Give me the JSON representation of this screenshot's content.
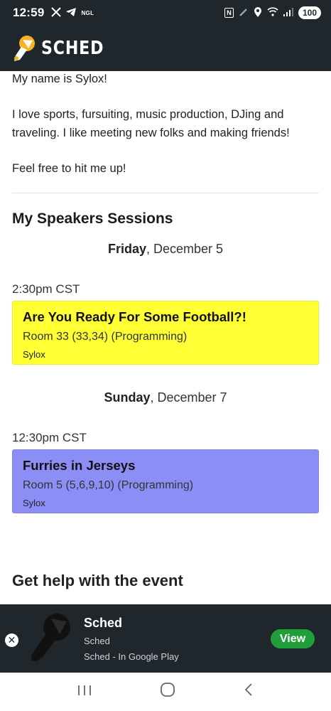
{
  "status_bar": {
    "time": "12:59",
    "left_icons": [
      "x-icon",
      "telegram-icon",
      "ngl-icon"
    ],
    "ngl_text": "NGL",
    "nfc_text": "N",
    "battery": "100"
  },
  "header": {
    "logo_text": "SCHED"
  },
  "bio": {
    "line1": "My name is Sylox!",
    "line2": "I love sports, fursuiting, music production, DJing and traveling. I like meeting new folks and making friends!",
    "line3": "Feel free to hit me up!"
  },
  "speaker_sessions": {
    "title": "My Speakers Sessions",
    "days": [
      {
        "weekday": "Friday",
        "date": ", December 5",
        "time": "2:30pm CST",
        "session": {
          "title": "Are You Ready For Some Football?!",
          "room": "Room 33 (33,34) (Programming)",
          "speaker": "Sylox",
          "color": "#ffff33"
        }
      },
      {
        "weekday": "Sunday",
        "date": ", December 7",
        "time": "12:30pm CST",
        "session": {
          "title": "Furries in Jerseys",
          "room": "Room 5 (5,6,9,10) (Programming)",
          "speaker": "Sylox",
          "color": "#8b8ff5"
        }
      }
    ]
  },
  "help": {
    "title": "Get help with the event"
  },
  "install_banner": {
    "close_glyph": "✕",
    "app_name": "Sched",
    "developer": "Sched",
    "store": "Sched - In Google Play",
    "view_label": "View",
    "accent": "#1f9e3a"
  },
  "nav_bar": {
    "recents_glyph": "|||",
    "home_glyph": "○",
    "back_glyph": "‹"
  },
  "colors": {
    "header_bg": "#1f272d",
    "friday_card": "#ffff33",
    "sunday_card": "#8b8ff5"
  }
}
